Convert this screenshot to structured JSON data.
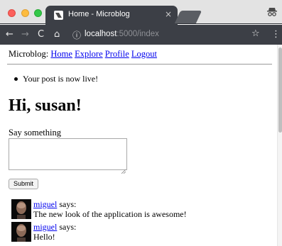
{
  "browser": {
    "tab_title": "Home - Microblog",
    "tab_close": "×",
    "url_host": "localhost",
    "url_rest": ":5000/index",
    "icons": {
      "back": "arrow-left-icon",
      "forward": "arrow-right-icon",
      "reload": "reload-icon",
      "home": "home-icon",
      "info": "info-icon",
      "bookmark": "star-icon",
      "menu": "kebab-menu-icon",
      "incognito": "incognito-icon"
    }
  },
  "nav": {
    "brand": "Microblog:",
    "links": [
      "Home",
      "Explore",
      "Profile",
      "Logout"
    ]
  },
  "flash_message": "Your post is now live!",
  "heading": "Hi, susan!",
  "form": {
    "label": "Say something",
    "value": "",
    "submit_label": "Submit"
  },
  "posts": [
    {
      "author": "miguel",
      "says": "says:",
      "body": "The new look of the application is awesome!"
    },
    {
      "author": "miguel",
      "says": "says:",
      "body": "Hello!"
    }
  ]
}
